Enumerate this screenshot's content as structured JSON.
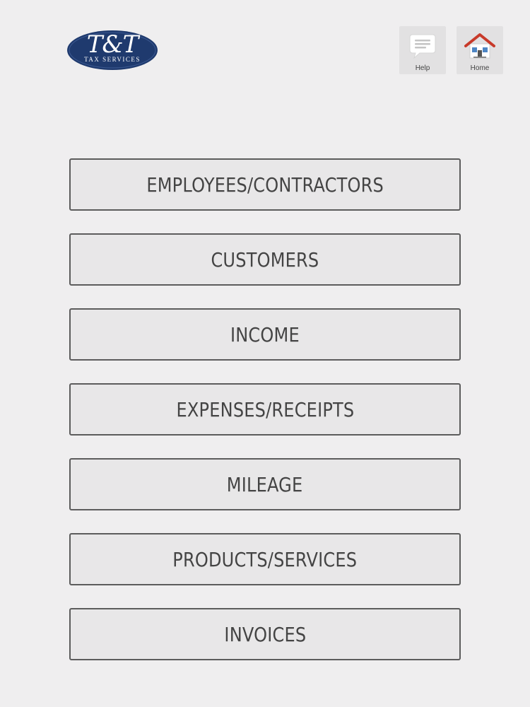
{
  "logo": {
    "script": "T&T",
    "subtitle": "TAX SERVICES",
    "color": "#1f3a6e"
  },
  "toolbar": {
    "help": {
      "label": "Help",
      "icon": "chat-bubble-icon"
    },
    "home": {
      "label": "Home",
      "icon": "house-icon"
    }
  },
  "menu": {
    "items": [
      {
        "label": "EMPLOYEES/CONTRACTORS"
      },
      {
        "label": "CUSTOMERS"
      },
      {
        "label": "INCOME"
      },
      {
        "label": "EXPENSES/RECEIPTS"
      },
      {
        "label": "MILEAGE"
      },
      {
        "label": "PRODUCTS/SERVICES"
      },
      {
        "label": "INVOICES"
      }
    ]
  },
  "colors": {
    "background": "#efeeef",
    "button_border": "#5c5c5c",
    "button_text": "#444444",
    "home_roof": "#c83a2a"
  }
}
